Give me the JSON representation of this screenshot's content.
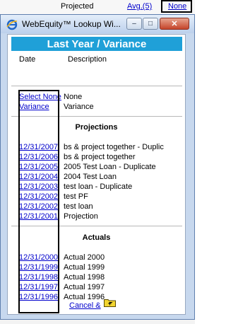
{
  "background": {
    "projected_label": "Projected",
    "avg_link": "Avg.(5)",
    "none_link": "None"
  },
  "window": {
    "title": "WebEquity™ Lookup Wi...",
    "minimize_glyph": "–",
    "maximize_glyph": "□",
    "close_glyph": "✕"
  },
  "panel": {
    "header": "Last Year / Variance",
    "col_date": "Date",
    "col_description": "Description",
    "top_rows": [
      {
        "link": "Select None",
        "desc": "None"
      },
      {
        "link": "Variance",
        "desc": "Variance"
      }
    ],
    "projections_heading": "Projections",
    "projections": [
      {
        "date": "12/31/2007",
        "desc": "bs & project together - Duplic"
      },
      {
        "date": "12/31/2006",
        "desc": "bs & project together"
      },
      {
        "date": "12/31/2005",
        "desc": "2005 Test Loan - Duplicate"
      },
      {
        "date": "12/31/2004",
        "desc": "2004 Test Loan"
      },
      {
        "date": "12/31/2003",
        "desc": "test loan - Duplicate"
      },
      {
        "date": "12/31/2002",
        "desc": "test PF"
      },
      {
        "date": "12/31/2002",
        "desc": "test loan"
      },
      {
        "date": "12/31/2001",
        "desc": "Projection"
      }
    ],
    "actuals_heading": "Actuals",
    "actuals": [
      {
        "date": "12/31/2000",
        "desc": "Actual 2000"
      },
      {
        "date": "12/31/1999",
        "desc": "Actual 1999"
      },
      {
        "date": "12/31/1998",
        "desc": "Actual 1998"
      },
      {
        "date": "12/31/1997",
        "desc": "Actual 1997"
      },
      {
        "date": "12/31/1996",
        "desc": "Actual 1996"
      }
    ],
    "cancel_label": "Cancel &"
  },
  "colors": {
    "header_bg": "#1fa0d8",
    "link": "#0000cc",
    "window_frame": "#c7d8ee"
  }
}
